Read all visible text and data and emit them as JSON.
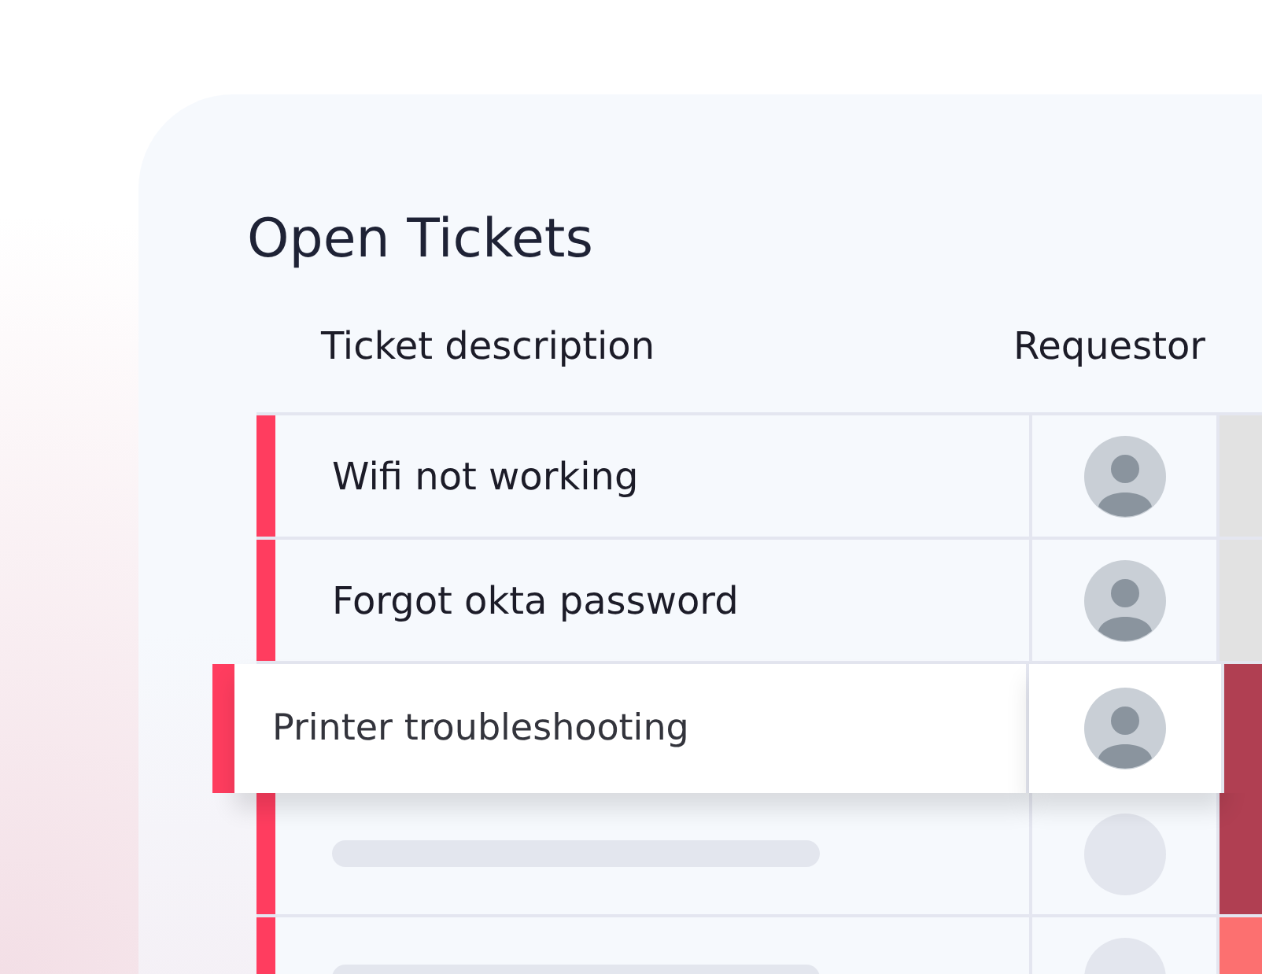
{
  "title": "Open Tickets",
  "columns": [
    "Ticket description",
    "Requestor"
  ],
  "rows": [
    {
      "kind": "ticket",
      "description": "Wifi not working",
      "selected": false,
      "color": "#e2e2e2"
    },
    {
      "kind": "ticket",
      "description": "Forgot okta password",
      "selected": false,
      "color": "#e2e2e2"
    },
    {
      "kind": "ticket",
      "description": "Printer troubleshooting",
      "selected": true,
      "color": "#b03f52"
    },
    {
      "kind": "placeholder",
      "selected": false,
      "color": "#b03f52"
    },
    {
      "kind": "placeholder",
      "selected": false,
      "color": "#fc7070"
    }
  ]
}
